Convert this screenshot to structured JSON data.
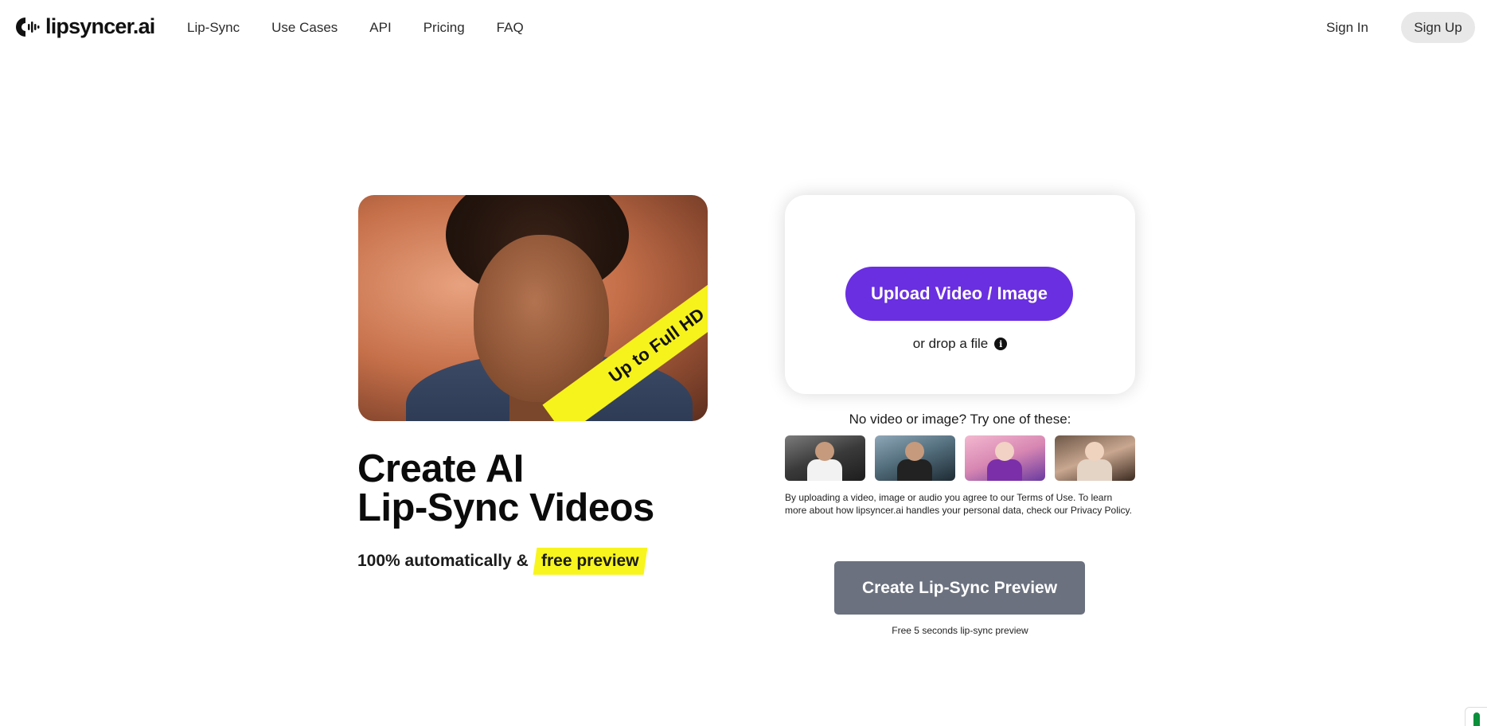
{
  "brand": {
    "name": "lipsyncer.ai",
    "logo_icon": "soundwave-logo-icon"
  },
  "nav": {
    "items": [
      {
        "label": "Lip-Sync"
      },
      {
        "label": "Use Cases"
      },
      {
        "label": "API"
      },
      {
        "label": "Pricing"
      },
      {
        "label": "FAQ"
      }
    ]
  },
  "auth": {
    "sign_in": "Sign In",
    "sign_up": "Sign Up"
  },
  "hero": {
    "badge": "Up to Full HD",
    "title_line1": "Create AI",
    "title_line2": "Lip-Sync Videos",
    "subtitle_prefix": "100% automatically &",
    "subtitle_highlight": "free preview"
  },
  "upload": {
    "button_label": "Upload Video / Image",
    "drop_text": "or drop a file",
    "info_icon": "info-icon",
    "try_text": "No video or image? Try one of these:",
    "samples": [
      {
        "name": "sample-chef"
      },
      {
        "name": "sample-street"
      },
      {
        "name": "sample-cherry-blossom"
      },
      {
        "name": "sample-cafe"
      }
    ],
    "terms": "By uploading a video, image or audio you agree to our Terms of Use. To learn more about how lipsyncer.ai handles your personal data, check our Privacy Policy."
  },
  "cta": {
    "button_label": "Create Lip-Sync Preview",
    "note": "Free 5 seconds lip-sync preview"
  },
  "colors": {
    "accent": "#6a2fe0",
    "highlight": "#f8f51e",
    "cta_disabled": "#6b717f",
    "signup_bg": "#e8e8e8"
  }
}
